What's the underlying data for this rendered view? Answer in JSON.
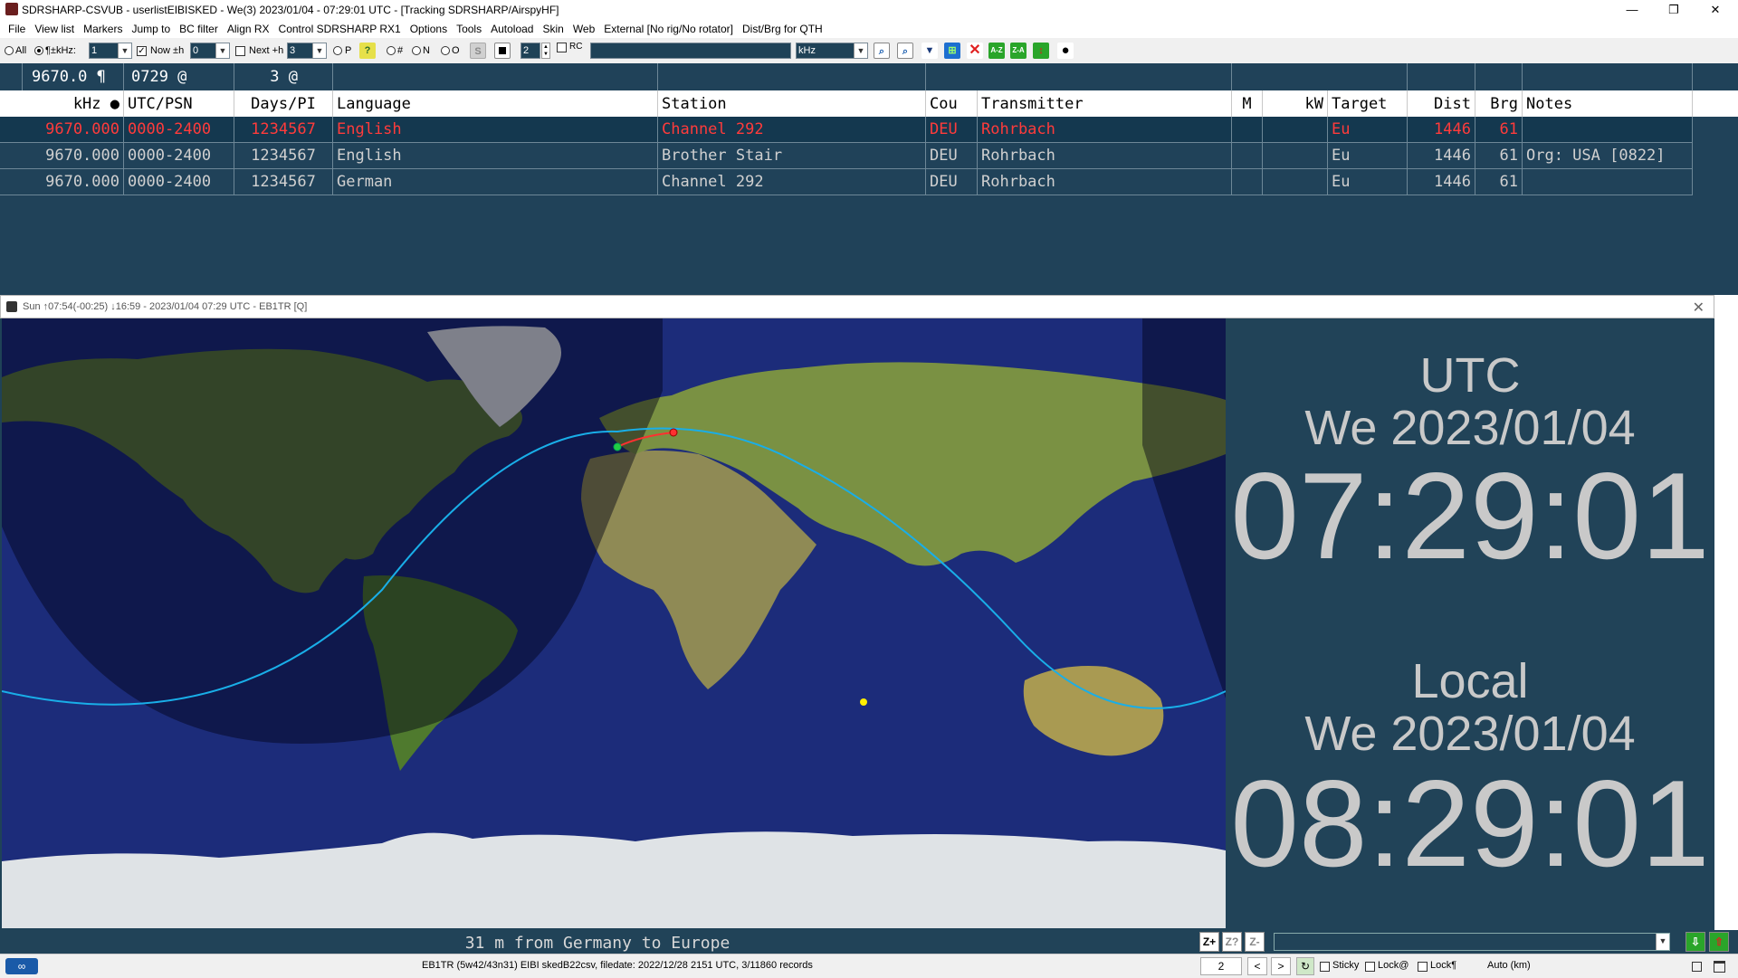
{
  "window": {
    "title": "SDRSHARP-CSVUB - userlistEIBISKED - We(3) 2023/01/04 - 07:29:01 UTC - [Tracking SDRSHARP/AirspyHF]",
    "controls": [
      "—",
      "❐",
      "✕"
    ]
  },
  "menu": [
    "File",
    "View list",
    "Markers",
    "Jump to",
    "BC filter",
    "Align RX",
    "Control SDRSHARP RX1",
    "Options",
    "Tools",
    "Autoload",
    "Skin",
    "Web",
    "External [No rig/No rotator]",
    "Dist/Brg for QTH"
  ],
  "toolbar": {
    "all_label": "All",
    "khz_label": "¶±kHz:",
    "khz_value": "1",
    "now_label": "Now ±h",
    "now_value": "0",
    "next_label": "Next +h",
    "next_value": "3",
    "p_label": "P",
    "hash_label": "#",
    "n_label": "N",
    "o_label": "O",
    "s_label": "S",
    "spin_value": "2",
    "rc_label": "RC",
    "search_value": "",
    "unit_value": "kHz",
    "az_label": "A-Z",
    "za_label": "Z-A"
  },
  "freqbar": {
    "freq": "9670.0 ¶",
    "time": "0729 @",
    "count": "3 @"
  },
  "columns": [
    "kHz ●",
    "UTC/PSN",
    "Days/PI",
    "Language",
    "Station",
    "Cou",
    "Transmitter",
    "M",
    "kW",
    "Target",
    "Dist",
    "Brg",
    "Notes"
  ],
  "rows": [
    {
      "khz": "9670.000",
      "utc": "0000-2400",
      "days": "1234567",
      "language": "English",
      "station": "Channel 292",
      "cou": "DEU",
      "transmitter": "Rohrbach",
      "m": "",
      "kw": "",
      "target": "Eu",
      "dist": "1446",
      "brg": "61",
      "notes": ""
    },
    {
      "khz": "9670.000",
      "utc": "0000-2400",
      "days": "1234567",
      "language": "English",
      "station": "Brother Stair",
      "cou": "DEU",
      "transmitter": "Rohrbach",
      "m": "",
      "kw": "",
      "target": "Eu",
      "dist": "1446",
      "brg": "61",
      "notes": "Org: USA [0822]"
    },
    {
      "khz": "9670.000",
      "utc": "0000-2400",
      "days": "1234567",
      "language": "German",
      "station": "Channel 292",
      "cou": "DEU",
      "transmitter": "Rohrbach",
      "m": "",
      "kw": "",
      "target": "Eu",
      "dist": "1446",
      "brg": "61",
      "notes": ""
    }
  ],
  "map_window": {
    "title": "Sun ↑07:54(-00:25) ↓16:59 - 2023/01/04 07:29 UTC - EB1TR [Q]",
    "close": "✕"
  },
  "clock": {
    "utc_label": "UTC",
    "utc_date": "We 2023/01/04",
    "utc_time": "07:29:01",
    "local_label": "Local",
    "local_date": "We 2023/01/04",
    "local_time": "08:29:01"
  },
  "path_status": "31 m from Germany to Europe",
  "statusbar": {
    "info": "EB1TR (5w42/43n31) EIBI skedB22csv, filedate: 2022/12/28 2151 UTC, 3/11860 records",
    "page": "2",
    "prev": "<",
    "next": ">",
    "sticky": "Sticky",
    "lock_at": "Lock@",
    "lock_para": "Lock¶",
    "auto": "Auto (km)"
  },
  "colors": {
    "panel": "#204259",
    "selected_text": "#ff3b3b",
    "path_line": "#19aee8",
    "clock_text": "#c9c9c9"
  }
}
